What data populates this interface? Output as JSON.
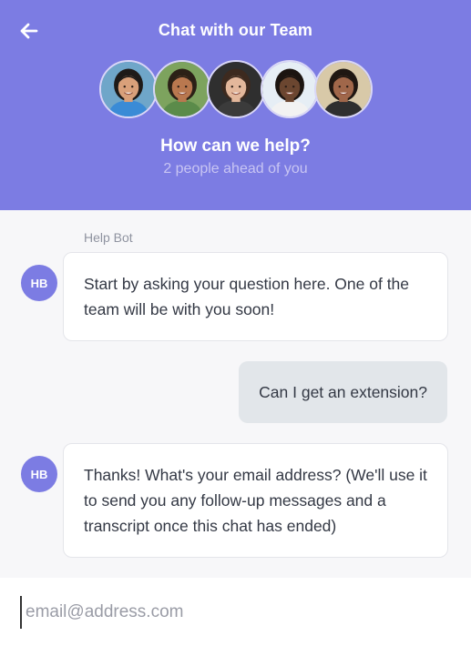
{
  "header": {
    "title": "Chat with our Team",
    "help_title": "How can we help?",
    "queue_status": "2 people ahead of you",
    "background_color": "#7c7ce3",
    "back_icon": "arrow-left-icon",
    "team_avatars": [
      {
        "name": "team-member-1",
        "skin": "#d9a07a",
        "hair": "#1e1a18",
        "shirt": "#3a8bd6",
        "bg": "#6fa6c9"
      },
      {
        "name": "team-member-2",
        "skin": "#b9784f",
        "hair": "#2b2016",
        "shirt": "#5b8b4a",
        "bg": "#7da35e"
      },
      {
        "name": "team-member-3",
        "skin": "#e3b79b",
        "hair": "#3d2a1f",
        "shirt": "#3b3b3b",
        "bg": "#2f2f2f"
      },
      {
        "name": "team-member-4",
        "skin": "#6b4630",
        "hair": "#1b1410",
        "shirt": "#f2f2f2",
        "bg": "#e6eef5"
      },
      {
        "name": "team-member-5",
        "skin": "#a0674a",
        "hair": "#1f1712",
        "shirt": "#2f2f2f",
        "bg": "#d8c9a8"
      }
    ]
  },
  "chat": {
    "sender_label": "Help Bot",
    "bot_initials": "HB",
    "messages": [
      {
        "from": "bot",
        "text": "Start by asking your question here. One of the team will be with you soon!"
      },
      {
        "from": "user",
        "text": "Can I get an extension?"
      },
      {
        "from": "bot",
        "text": "Thanks! What's your email address? (We'll use it to send you any follow-up messages and a transcript once this chat has ended)"
      }
    ]
  },
  "composer": {
    "placeholder": "email@address.com",
    "value": ""
  }
}
